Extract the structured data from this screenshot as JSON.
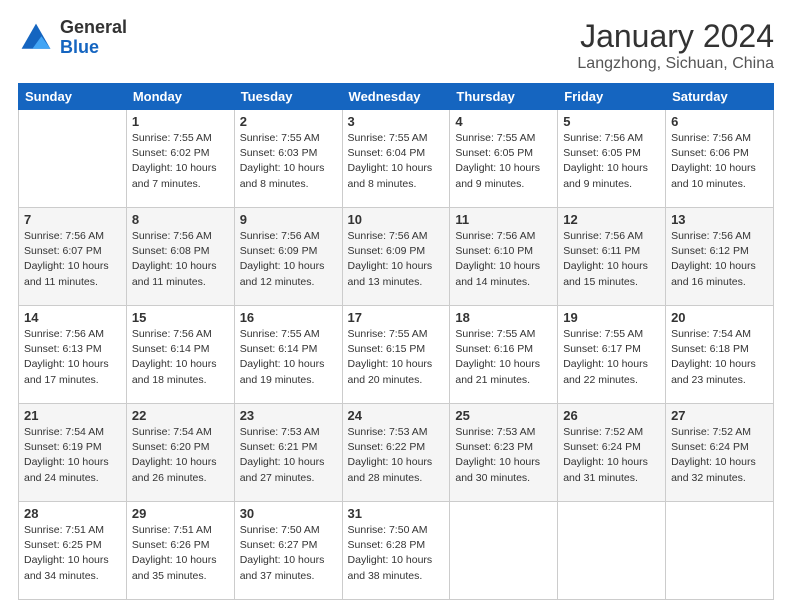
{
  "header": {
    "logo_general": "General",
    "logo_blue": "Blue",
    "month_title": "January 2024",
    "location": "Langzhong, Sichuan, China"
  },
  "weekdays": [
    "Sunday",
    "Monday",
    "Tuesday",
    "Wednesday",
    "Thursday",
    "Friday",
    "Saturday"
  ],
  "weeks": [
    [
      {
        "day": "",
        "info": ""
      },
      {
        "day": "1",
        "info": "Sunrise: 7:55 AM\nSunset: 6:02 PM\nDaylight: 10 hours\nand 7 minutes."
      },
      {
        "day": "2",
        "info": "Sunrise: 7:55 AM\nSunset: 6:03 PM\nDaylight: 10 hours\nand 8 minutes."
      },
      {
        "day": "3",
        "info": "Sunrise: 7:55 AM\nSunset: 6:04 PM\nDaylight: 10 hours\nand 8 minutes."
      },
      {
        "day": "4",
        "info": "Sunrise: 7:55 AM\nSunset: 6:05 PM\nDaylight: 10 hours\nand 9 minutes."
      },
      {
        "day": "5",
        "info": "Sunrise: 7:56 AM\nSunset: 6:05 PM\nDaylight: 10 hours\nand 9 minutes."
      },
      {
        "day": "6",
        "info": "Sunrise: 7:56 AM\nSunset: 6:06 PM\nDaylight: 10 hours\nand 10 minutes."
      }
    ],
    [
      {
        "day": "7",
        "info": "Sunrise: 7:56 AM\nSunset: 6:07 PM\nDaylight: 10 hours\nand 11 minutes."
      },
      {
        "day": "8",
        "info": "Sunrise: 7:56 AM\nSunset: 6:08 PM\nDaylight: 10 hours\nand 11 minutes."
      },
      {
        "day": "9",
        "info": "Sunrise: 7:56 AM\nSunset: 6:09 PM\nDaylight: 10 hours\nand 12 minutes."
      },
      {
        "day": "10",
        "info": "Sunrise: 7:56 AM\nSunset: 6:09 PM\nDaylight: 10 hours\nand 13 minutes."
      },
      {
        "day": "11",
        "info": "Sunrise: 7:56 AM\nSunset: 6:10 PM\nDaylight: 10 hours\nand 14 minutes."
      },
      {
        "day": "12",
        "info": "Sunrise: 7:56 AM\nSunset: 6:11 PM\nDaylight: 10 hours\nand 15 minutes."
      },
      {
        "day": "13",
        "info": "Sunrise: 7:56 AM\nSunset: 6:12 PM\nDaylight: 10 hours\nand 16 minutes."
      }
    ],
    [
      {
        "day": "14",
        "info": "Sunrise: 7:56 AM\nSunset: 6:13 PM\nDaylight: 10 hours\nand 17 minutes."
      },
      {
        "day": "15",
        "info": "Sunrise: 7:56 AM\nSunset: 6:14 PM\nDaylight: 10 hours\nand 18 minutes."
      },
      {
        "day": "16",
        "info": "Sunrise: 7:55 AM\nSunset: 6:14 PM\nDaylight: 10 hours\nand 19 minutes."
      },
      {
        "day": "17",
        "info": "Sunrise: 7:55 AM\nSunset: 6:15 PM\nDaylight: 10 hours\nand 20 minutes."
      },
      {
        "day": "18",
        "info": "Sunrise: 7:55 AM\nSunset: 6:16 PM\nDaylight: 10 hours\nand 21 minutes."
      },
      {
        "day": "19",
        "info": "Sunrise: 7:55 AM\nSunset: 6:17 PM\nDaylight: 10 hours\nand 22 minutes."
      },
      {
        "day": "20",
        "info": "Sunrise: 7:54 AM\nSunset: 6:18 PM\nDaylight: 10 hours\nand 23 minutes."
      }
    ],
    [
      {
        "day": "21",
        "info": "Sunrise: 7:54 AM\nSunset: 6:19 PM\nDaylight: 10 hours\nand 24 minutes."
      },
      {
        "day": "22",
        "info": "Sunrise: 7:54 AM\nSunset: 6:20 PM\nDaylight: 10 hours\nand 26 minutes."
      },
      {
        "day": "23",
        "info": "Sunrise: 7:53 AM\nSunset: 6:21 PM\nDaylight: 10 hours\nand 27 minutes."
      },
      {
        "day": "24",
        "info": "Sunrise: 7:53 AM\nSunset: 6:22 PM\nDaylight: 10 hours\nand 28 minutes."
      },
      {
        "day": "25",
        "info": "Sunrise: 7:53 AM\nSunset: 6:23 PM\nDaylight: 10 hours\nand 30 minutes."
      },
      {
        "day": "26",
        "info": "Sunrise: 7:52 AM\nSunset: 6:24 PM\nDaylight: 10 hours\nand 31 minutes."
      },
      {
        "day": "27",
        "info": "Sunrise: 7:52 AM\nSunset: 6:24 PM\nDaylight: 10 hours\nand 32 minutes."
      }
    ],
    [
      {
        "day": "28",
        "info": "Sunrise: 7:51 AM\nSunset: 6:25 PM\nDaylight: 10 hours\nand 34 minutes."
      },
      {
        "day": "29",
        "info": "Sunrise: 7:51 AM\nSunset: 6:26 PM\nDaylight: 10 hours\nand 35 minutes."
      },
      {
        "day": "30",
        "info": "Sunrise: 7:50 AM\nSunset: 6:27 PM\nDaylight: 10 hours\nand 37 minutes."
      },
      {
        "day": "31",
        "info": "Sunrise: 7:50 AM\nSunset: 6:28 PM\nDaylight: 10 hours\nand 38 minutes."
      },
      {
        "day": "",
        "info": ""
      },
      {
        "day": "",
        "info": ""
      },
      {
        "day": "",
        "info": ""
      }
    ]
  ]
}
